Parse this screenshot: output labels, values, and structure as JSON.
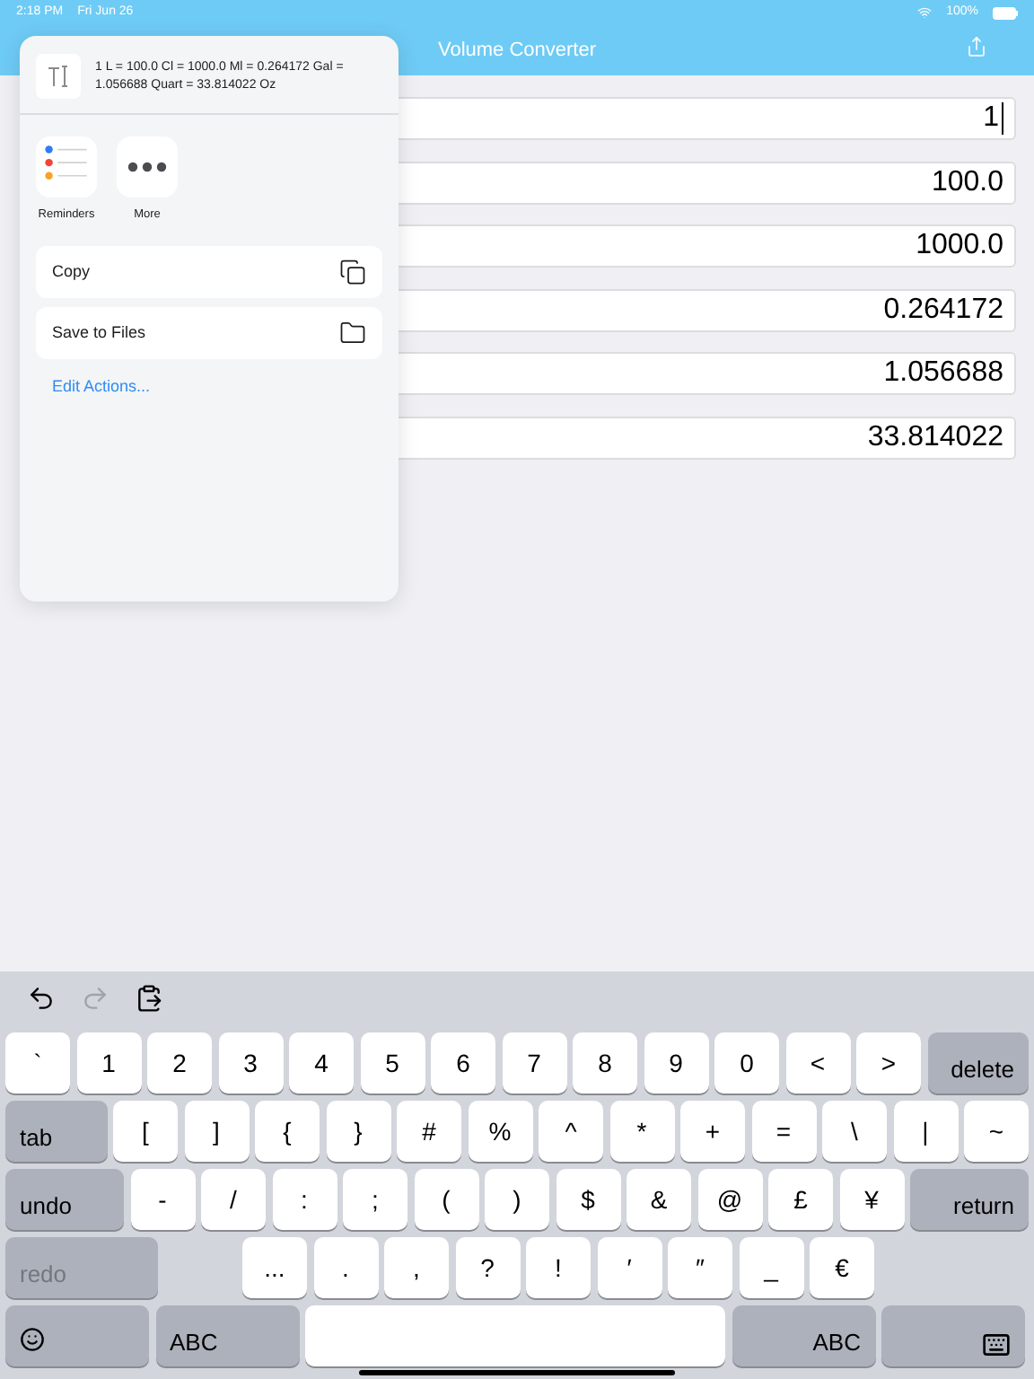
{
  "status_bar": {
    "time": "2:18 PM",
    "date": "Fri Jun 26",
    "battery": "100%"
  },
  "nav_bar": {
    "title": "Volume Converter"
  },
  "fields": [
    {
      "value": "1",
      "focused": true
    },
    {
      "value": "100.0",
      "focused": false
    },
    {
      "value": "1000.0",
      "focused": false
    },
    {
      "value": "0.264172",
      "focused": false
    },
    {
      "value": "1.056688",
      "focused": false
    },
    {
      "value": "33.814022",
      "focused": false
    }
  ],
  "share_sheet": {
    "preview_text": "1 L = 100.0 Cl = 1000.0 Ml = 0.264172 Gal = 1.056688 Quart = 33.814022 Oz",
    "apps": [
      {
        "label": "Reminders",
        "kind": "reminders"
      },
      {
        "label": "More",
        "kind": "more"
      }
    ],
    "actions": [
      {
        "label": "Copy",
        "kind": "copy"
      },
      {
        "label": "Save to Files",
        "kind": "folder"
      }
    ],
    "edit_link": "Edit Actions..."
  },
  "keyboard": {
    "toolbar": [
      {
        "kind": "undo",
        "disabled": false
      },
      {
        "kind": "redo",
        "disabled": true
      },
      {
        "kind": "paste",
        "disabled": false
      }
    ],
    "key_rows": [
      {
        "keys": [
          {
            "label": "`",
            "kind": "char"
          },
          {
            "label": "1",
            "kind": "char"
          },
          {
            "label": "2",
            "kind": "char"
          },
          {
            "label": "3",
            "kind": "char"
          },
          {
            "label": "4",
            "kind": "char"
          },
          {
            "label": "5",
            "kind": "char"
          },
          {
            "label": "6",
            "kind": "char"
          },
          {
            "label": "7",
            "kind": "char"
          },
          {
            "label": "8",
            "kind": "char"
          },
          {
            "label": "9",
            "kind": "char"
          },
          {
            "label": "0",
            "kind": "char"
          },
          {
            "label": "<",
            "kind": "char"
          },
          {
            "label": ">",
            "kind": "char"
          },
          {
            "label": "delete",
            "kind": "fn-right",
            "disabled": false
          }
        ]
      },
      {
        "keys": [
          {
            "label": "tab",
            "kind": "fn-left",
            "disabled": false
          },
          {
            "label": "[",
            "kind": "char"
          },
          {
            "label": "]",
            "kind": "char"
          },
          {
            "label": "{",
            "kind": "char"
          },
          {
            "label": "}",
            "kind": "char"
          },
          {
            "label": "#",
            "kind": "char"
          },
          {
            "label": "%",
            "kind": "char"
          },
          {
            "label": "^",
            "kind": "char"
          },
          {
            "label": "*",
            "kind": "char"
          },
          {
            "label": "+",
            "kind": "char"
          },
          {
            "label": "=",
            "kind": "char"
          },
          {
            "label": "\\",
            "kind": "char"
          },
          {
            "label": "|",
            "kind": "char"
          },
          {
            "label": "~",
            "kind": "char"
          }
        ]
      },
      {
        "keys": [
          {
            "label": "undo",
            "kind": "fn-left",
            "disabled": false
          },
          {
            "label": "-",
            "kind": "char"
          },
          {
            "label": "/",
            "kind": "char"
          },
          {
            "label": ":",
            "kind": "char"
          },
          {
            "label": ";",
            "kind": "char"
          },
          {
            "label": "(",
            "kind": "char"
          },
          {
            "label": ")",
            "kind": "char"
          },
          {
            "label": "$",
            "kind": "char"
          },
          {
            "label": "&",
            "kind": "char"
          },
          {
            "label": "@",
            "kind": "char"
          },
          {
            "label": "£",
            "kind": "char"
          },
          {
            "label": "¥",
            "kind": "char"
          },
          {
            "label": "return",
            "kind": "fn-right",
            "disabled": false
          }
        ]
      },
      {
        "keys": [
          {
            "label": "redo",
            "kind": "fn-left",
            "disabled": true
          },
          {
            "label": "...",
            "kind": "char"
          },
          {
            "label": ".",
            "kind": "char"
          },
          {
            "label": ",",
            "kind": "char"
          },
          {
            "label": "?",
            "kind": "char"
          },
          {
            "label": "!",
            "kind": "char"
          },
          {
            "label": "′",
            "kind": "char"
          },
          {
            "label": "″",
            "kind": "char"
          },
          {
            "label": "_",
            "kind": "char"
          },
          {
            "label": "€",
            "kind": "char"
          }
        ]
      },
      {
        "keys": [
          {
            "kind": "emoji"
          },
          {
            "label": "ABC",
            "kind": "fn-left",
            "disabled": false
          },
          {
            "kind": "space"
          },
          {
            "label": "ABC",
            "kind": "fn-right",
            "disabled": false
          },
          {
            "kind": "hide-keyboard"
          }
        ]
      }
    ]
  }
}
